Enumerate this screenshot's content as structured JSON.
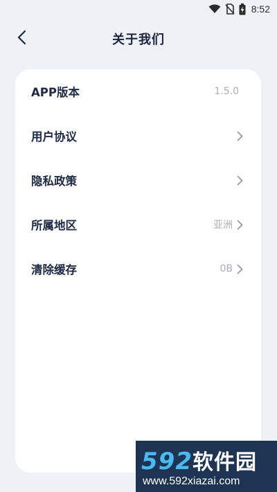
{
  "status_bar": {
    "time": "8:52",
    "icons": [
      "wifi-icon",
      "no-sim-icon",
      "battery-charging-icon"
    ]
  },
  "header": {
    "back_icon": "chevron-left-icon",
    "title": "关于我们"
  },
  "settings": {
    "items": [
      {
        "label": "APP版本",
        "value": "1.5.0",
        "has_chevron": false
      },
      {
        "label": "用户协议",
        "value": "",
        "has_chevron": true
      },
      {
        "label": "隐私政策",
        "value": "",
        "has_chevron": true
      },
      {
        "label": "所属地区",
        "value": "亚洲",
        "has_chevron": true
      },
      {
        "label": "清除缓存",
        "value": "0B",
        "has_chevron": true
      }
    ]
  },
  "watermark": {
    "logo_num": "592",
    "logo_cn": "软件园",
    "url": "www.592xiazai.com"
  },
  "colors": {
    "background": "#eef1f6",
    "card": "#ffffff",
    "text_primary": "#1f2a44",
    "text_secondary": "#a7adb8"
  }
}
